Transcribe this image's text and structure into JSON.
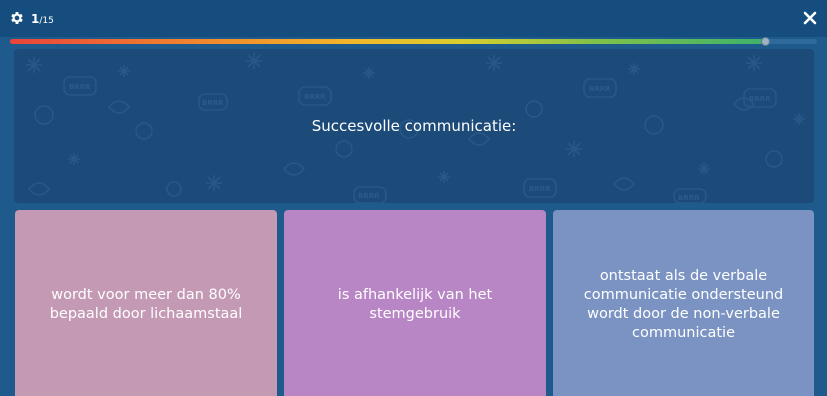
{
  "header": {
    "current": "1",
    "separator": "/",
    "total": "15",
    "settings_icon": "gear-icon",
    "close_icon": "close-icon"
  },
  "progress": {
    "fraction": 0.935
  },
  "question": {
    "text": "Succesvolle communicatie:",
    "background_doodles": [
      "BRRR",
      "BRRR",
      "BRRR",
      "BRRR",
      "BRRR",
      "BRRR",
      "BRRR",
      "BRRR"
    ]
  },
  "answers": [
    {
      "text": "wordt voor meer dan 80%\nbepaald door lichaamstaal",
      "color": "#c399b4"
    },
    {
      "text": "is afhankelijk van het\nstemgebruik",
      "color": "#b886c4"
    },
    {
      "text": "ontstaat als de verbale\ncommunicatie ondersteund\nwordt door de non-verbale\ncommunicatie",
      "color": "#7a93c3"
    }
  ],
  "colors": {
    "background": "#1f5a8c",
    "topbar": "#154e7e",
    "question_card": "#1c4a79"
  }
}
